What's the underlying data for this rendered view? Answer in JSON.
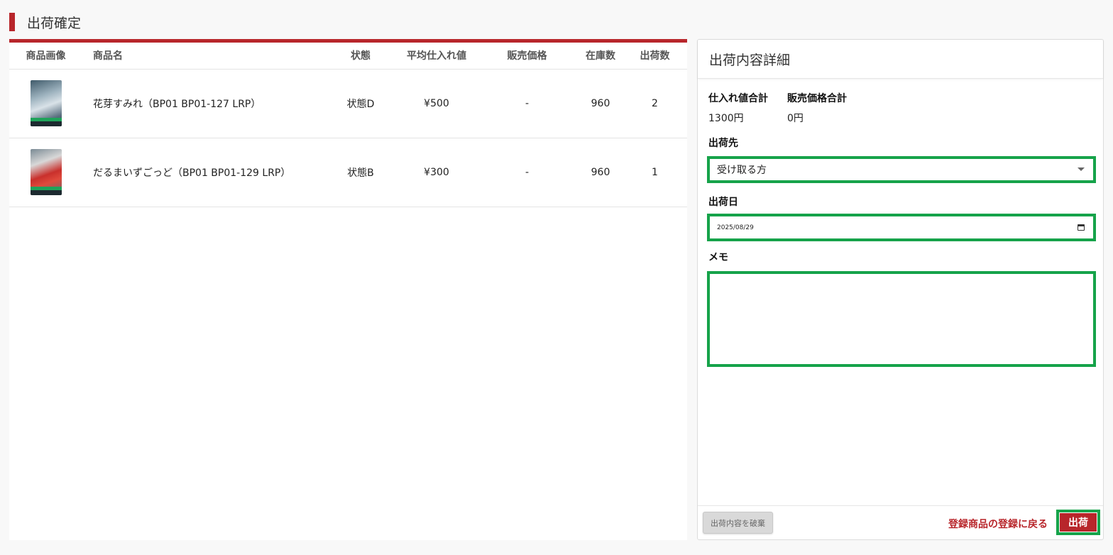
{
  "page": {
    "title": "出荷確定"
  },
  "table": {
    "headers": [
      "商品画像",
      "商品名",
      "状態",
      "平均仕入れ値",
      "販売価格",
      "在庫数",
      "出荷数"
    ],
    "rows": [
      {
        "image_icon": "card-thumbnail",
        "name": "花芽すみれ（BP01 BP01-127 LRP）",
        "condition": "状態D",
        "avg_cost": "¥500",
        "price": "-",
        "stock": "960",
        "ship_qty": "2"
      },
      {
        "image_icon": "card-thumbnail",
        "name": "だるまいずごっど（BP01 BP01-129 LRP）",
        "condition": "状態B",
        "avg_cost": "¥300",
        "price": "-",
        "stock": "960",
        "ship_qty": "1"
      }
    ]
  },
  "detail": {
    "title": "出荷内容詳細",
    "totals": {
      "cost_label": "仕入れ値合計",
      "cost_value": "1300円",
      "price_label": "販売価格合計",
      "price_value": "0円"
    },
    "destination": {
      "label": "出荷先",
      "value": "受け取る方"
    },
    "ship_date": {
      "label": "出荷日",
      "value": "2025/08/29"
    },
    "memo": {
      "label": "メモ",
      "value": ""
    },
    "footer": {
      "discard_label": "出荷内容を破棄",
      "back_label": "登録商品の登録に戻る",
      "ship_label": "出荷"
    }
  },
  "colors": {
    "accent": "#b8262b",
    "highlight": "#16a34a"
  }
}
